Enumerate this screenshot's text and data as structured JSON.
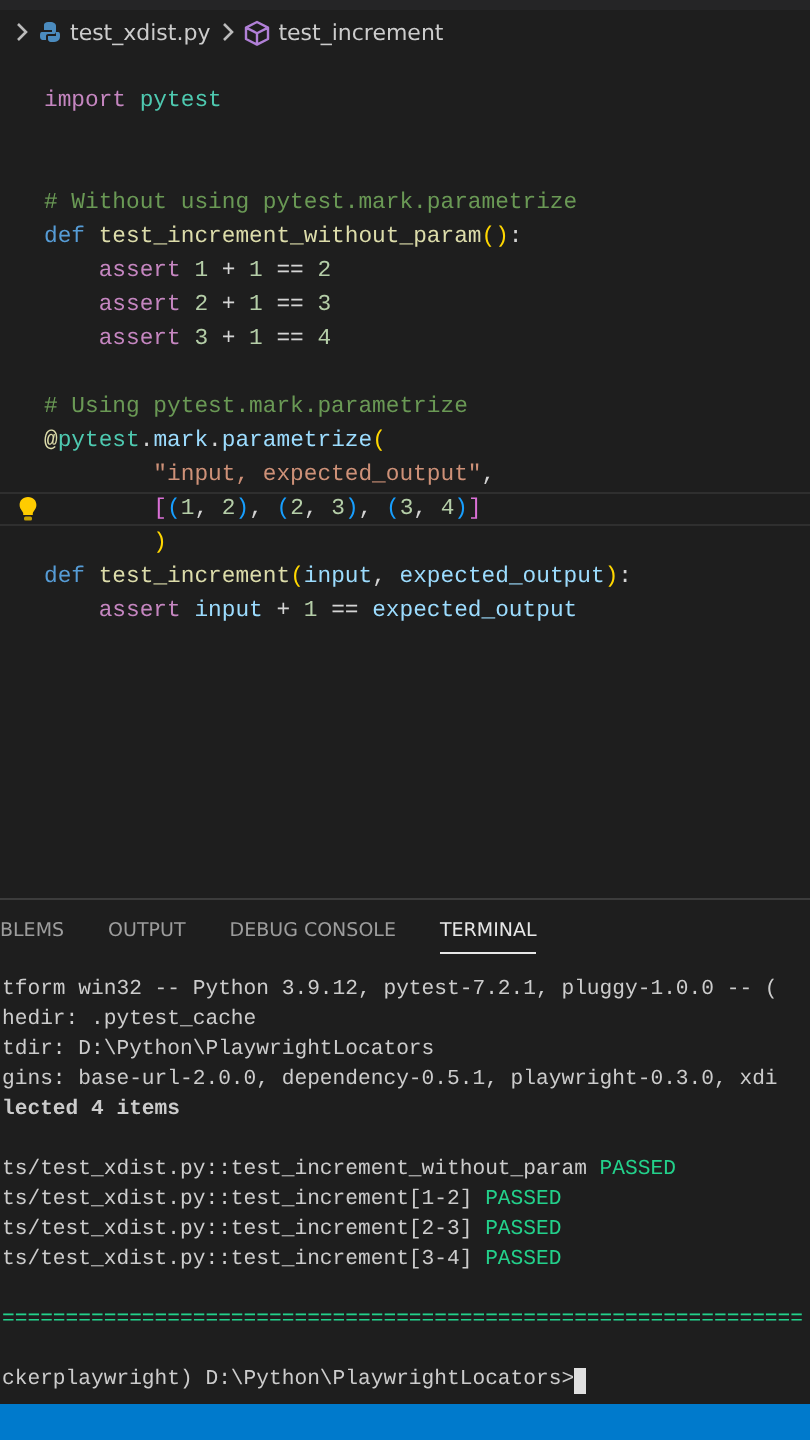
{
  "breadcrumbs": [
    {
      "kind": "file",
      "label": "test_xdist.py"
    },
    {
      "kind": "symbol",
      "label": "test_increment"
    }
  ],
  "code_lines": [
    {
      "kind": "code",
      "tokens": [
        {
          "t": "import",
          "kind": "kw"
        },
        {
          "t": " pytest",
          "kind": "mod"
        }
      ]
    },
    {
      "kind": "blank"
    },
    {
      "kind": "blank"
    },
    {
      "kind": "code",
      "tokens": [
        {
          "t": "# Without using pytest.mark.parametrize",
          "kind": "comment"
        }
      ]
    },
    {
      "kind": "code",
      "tokens": [
        {
          "t": "def",
          "kind": "def"
        },
        {
          "t": " test_increment_without_param",
          "kind": "fn"
        },
        {
          "t": "()",
          "kind": "br1"
        },
        {
          "t": ":",
          "kind": "op"
        }
      ]
    },
    {
      "kind": "code",
      "tokens": [
        {
          "t": "    assert",
          "kind": "kw"
        },
        {
          "t": " 1",
          "kind": "num"
        },
        {
          "t": " + ",
          "kind": "op"
        },
        {
          "t": "1",
          "kind": "num"
        },
        {
          "t": " == ",
          "kind": "op"
        },
        {
          "t": "2",
          "kind": "num"
        }
      ]
    },
    {
      "kind": "code",
      "tokens": [
        {
          "t": "    assert",
          "kind": "kw"
        },
        {
          "t": " 2",
          "kind": "num"
        },
        {
          "t": " + ",
          "kind": "op"
        },
        {
          "t": "1",
          "kind": "num"
        },
        {
          "t": " == ",
          "kind": "op"
        },
        {
          "t": "3",
          "kind": "num"
        }
      ]
    },
    {
      "kind": "code",
      "tokens": [
        {
          "t": "    assert",
          "kind": "kw"
        },
        {
          "t": " 3",
          "kind": "num"
        },
        {
          "t": " + ",
          "kind": "op"
        },
        {
          "t": "1",
          "kind": "num"
        },
        {
          "t": " == ",
          "kind": "op"
        },
        {
          "t": "4",
          "kind": "num"
        }
      ]
    },
    {
      "kind": "blank"
    },
    {
      "kind": "code",
      "tokens": [
        {
          "t": "# Using pytest.mark.parametrize",
          "kind": "comment"
        }
      ]
    },
    {
      "kind": "code",
      "tokens": [
        {
          "t": "@",
          "kind": "fn"
        },
        {
          "t": "pytest",
          "kind": "mod"
        },
        {
          "t": ".",
          "kind": "op"
        },
        {
          "t": "mark",
          "kind": "var"
        },
        {
          "t": ".",
          "kind": "op"
        },
        {
          "t": "parametrize",
          "kind": "var"
        },
        {
          "t": "(",
          "kind": "br1"
        }
      ]
    },
    {
      "kind": "code",
      "tokens": [
        {
          "t": "        \"input, expected_output\"",
          "kind": "str"
        },
        {
          "t": ",",
          "kind": "op"
        }
      ]
    },
    {
      "kind": "code",
      "current": true,
      "lightbulb": true,
      "tokens": [
        {
          "t": "        [",
          "kind": "br2"
        },
        {
          "t": "(",
          "kind": "br3"
        },
        {
          "t": "1",
          "kind": "num"
        },
        {
          "t": ", ",
          "kind": "op"
        },
        {
          "t": "2",
          "kind": "num"
        },
        {
          "t": ")",
          "kind": "br3"
        },
        {
          "t": ", ",
          "kind": "op"
        },
        {
          "t": "(",
          "kind": "br3"
        },
        {
          "t": "2",
          "kind": "num"
        },
        {
          "t": ", ",
          "kind": "op"
        },
        {
          "t": "3",
          "kind": "num"
        },
        {
          "t": ")",
          "kind": "br3"
        },
        {
          "t": ", ",
          "kind": "op"
        },
        {
          "t": "(",
          "kind": "br3"
        },
        {
          "t": "3",
          "kind": "num"
        },
        {
          "t": ", ",
          "kind": "op"
        },
        {
          "t": "4",
          "kind": "num"
        },
        {
          "t": ")",
          "kind": "br3"
        },
        {
          "t": "]",
          "kind": "br2"
        }
      ]
    },
    {
      "kind": "code",
      "tokens": [
        {
          "t": "        )",
          "kind": "br1"
        }
      ]
    },
    {
      "kind": "code",
      "tokens": [
        {
          "t": "def",
          "kind": "def"
        },
        {
          "t": " test_increment",
          "kind": "fn"
        },
        {
          "t": "(",
          "kind": "br1"
        },
        {
          "t": "input",
          "kind": "var"
        },
        {
          "t": ", ",
          "kind": "op"
        },
        {
          "t": "expected_output",
          "kind": "var"
        },
        {
          "t": ")",
          "kind": "br1"
        },
        {
          "t": ":",
          "kind": "op"
        }
      ]
    },
    {
      "kind": "code",
      "tokens": [
        {
          "t": "    assert",
          "kind": "kw"
        },
        {
          "t": " input",
          "kind": "var"
        },
        {
          "t": " + ",
          "kind": "op"
        },
        {
          "t": "1",
          "kind": "num"
        },
        {
          "t": " == ",
          "kind": "op"
        },
        {
          "t": "expected_output",
          "kind": "var"
        }
      ]
    }
  ],
  "panel_tabs": [
    {
      "label": "BLEMS",
      "selected": false
    },
    {
      "label": "OUTPUT",
      "selected": false
    },
    {
      "label": "DEBUG CONSOLE",
      "selected": false
    },
    {
      "label": "TERMINAL",
      "selected": true
    }
  ],
  "terminal_lines": [
    {
      "kind": "plain",
      "text": "tform win32 -- Python 3.9.12, pytest-7.2.1, pluggy-1.0.0 -- ("
    },
    {
      "kind": "plain",
      "text": "hedir: .pytest_cache"
    },
    {
      "kind": "plain",
      "text": "tdir: D:\\Python\\PlaywrightLocators"
    },
    {
      "kind": "plain",
      "text": "gins: base-url-2.0.0, dependency-0.5.1, playwright-0.3.0, xdi"
    },
    {
      "kind": "bold",
      "text": "lected 4 items"
    },
    {
      "kind": "blank"
    },
    {
      "kind": "result",
      "text": "ts/test_xdist.py::test_increment_without_param",
      "status": "PASSED"
    },
    {
      "kind": "result",
      "text": "ts/test_xdist.py::test_increment[1-2]",
      "status": "PASSED"
    },
    {
      "kind": "result",
      "text": "ts/test_xdist.py::test_increment[2-3]",
      "status": "PASSED"
    },
    {
      "kind": "result",
      "text": "ts/test_xdist.py::test_increment[3-4]",
      "status": "PASSED"
    },
    {
      "kind": "blank"
    },
    {
      "kind": "separator",
      "text": "==============================================================="
    },
    {
      "kind": "blank"
    },
    {
      "kind": "prompt",
      "text": "ckerplaywright) D:\\Python\\PlaywrightLocators>"
    }
  ]
}
